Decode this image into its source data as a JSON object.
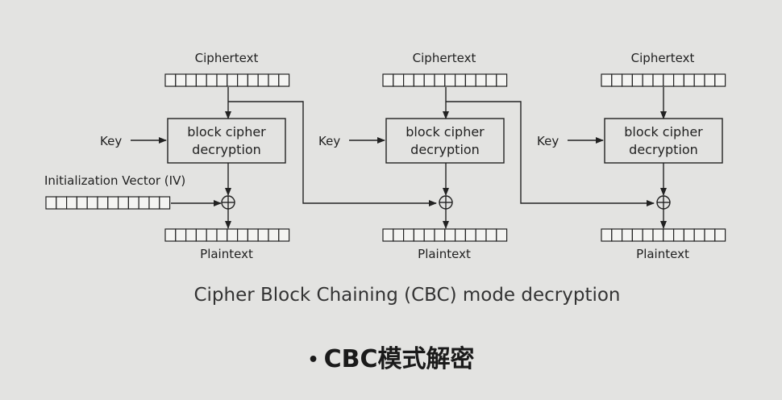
{
  "diagram": {
    "stages": [
      {
        "ciphertext_label": "Ciphertext",
        "key_label": "Key",
        "box_line1": "block cipher",
        "box_line2": "decryption",
        "plaintext_label": "Plaintext"
      },
      {
        "ciphertext_label": "Ciphertext",
        "key_label": "Key",
        "box_line1": "block cipher",
        "box_line2": "decryption",
        "plaintext_label": "Plaintext"
      },
      {
        "ciphertext_label": "Ciphertext",
        "key_label": "Key",
        "box_line1": "block cipher",
        "box_line2": "decryption",
        "plaintext_label": "Plaintext"
      }
    ],
    "iv_label": "Initialization Vector (IV)",
    "caption": "Cipher Block Chaining (CBC) mode decryption"
  },
  "slide": {
    "bullet": "•",
    "subtitle": "CBC模式解密"
  }
}
